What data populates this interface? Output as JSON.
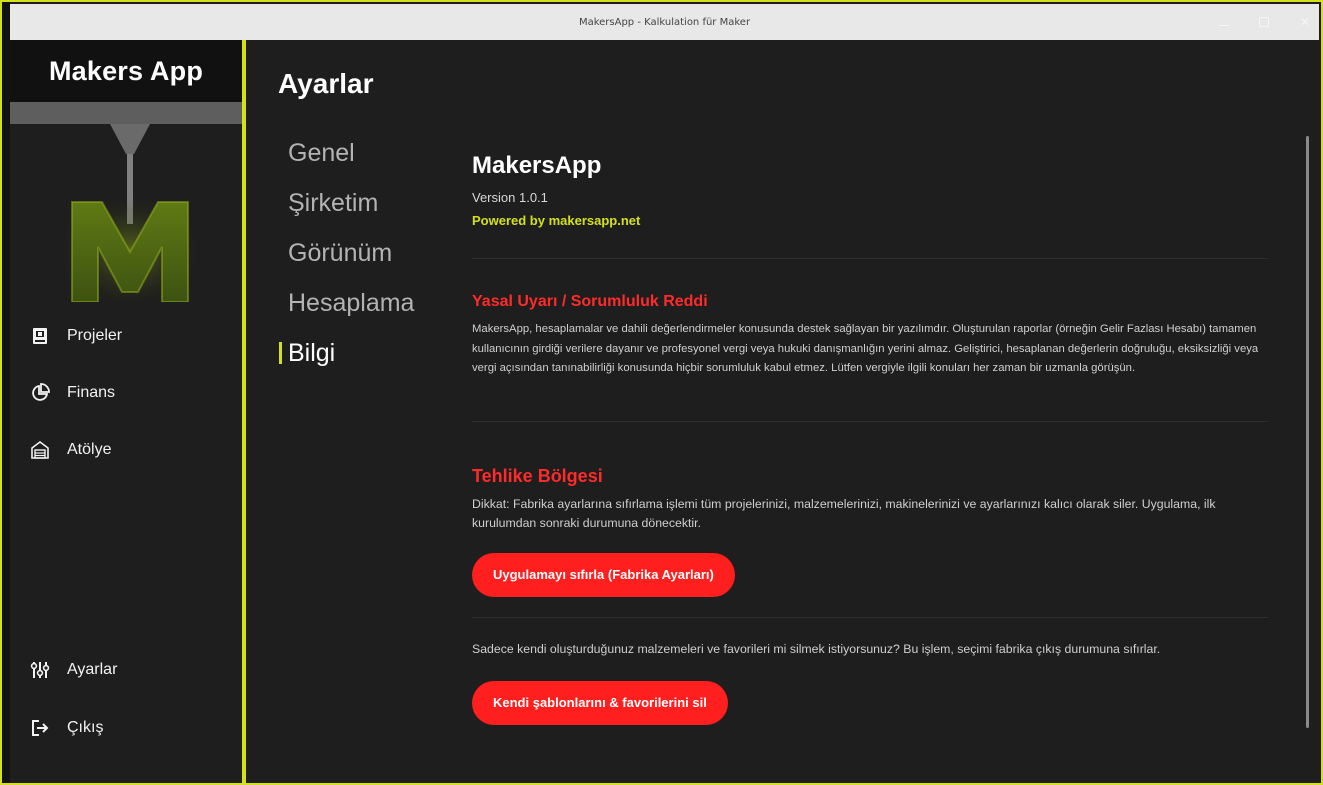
{
  "window": {
    "title": "MakersApp - Kalkulation für Maker"
  },
  "sidebar": {
    "brand": "Makers App",
    "items": [
      {
        "label": "Projeler",
        "icon": "projects-icon"
      },
      {
        "label": "Finans",
        "icon": "pie-chart-icon"
      },
      {
        "label": "Atölye",
        "icon": "garage-icon"
      }
    ],
    "bottom_items": [
      {
        "label": "Ayarlar",
        "icon": "sliders-icon"
      },
      {
        "label": "Çıkış",
        "icon": "logout-icon"
      }
    ]
  },
  "page": {
    "title": "Ayarlar"
  },
  "settings_nav": {
    "items": [
      "Genel",
      "Şirketim",
      "Görünüm",
      "Hesaplama",
      "Bilgi"
    ],
    "active": "Bilgi"
  },
  "info": {
    "app_name": "MakersApp",
    "version": "Version 1.0.1",
    "powered_by": "Powered by makersapp.net"
  },
  "disclaimer": {
    "title": "Yasal Uyarı / Sorumluluk Reddi",
    "text": "MakersApp, hesaplamalar ve dahili değerlendirmeler konusunda destek sağlayan bir yazılımdır. Oluşturulan raporlar (örneğin Gelir Fazlası Hesabı) tamamen kullanıcının girdiği verilere dayanır ve profesyonel vergi veya hukuki danışmanlığın yerini almaz. Geliştirici, hesaplanan değerlerin doğruluğu, eksiksizliği veya vergi açısından tanınabilirliği konusunda hiçbir sorumluluk kabul etmez. Lütfen vergiyle ilgili konuları her zaman bir uzmanla görüşün."
  },
  "danger_zone": {
    "title": "Tehlike Bölgesi",
    "text": "Dikkat: Fabrika ayarlarına sıfırlama işlemi tüm projelerinizi, malzemelerinizi, makinelerinizi ve ayarlarınızı kalıcı olarak siler. Uygulama, ilk kurulumdan sonraki durumuna dönecektir.",
    "reset_button": "Uygulamayı sıfırla (Fabrika Ayarları)",
    "templates_text": "Sadece kendi oluşturduğunuz malzemeleri ve favorileri mi silmek istiyorsunuz? Bu işlem, seçimi fabrika çıkış durumuna sıfırlar.",
    "delete_templates_button": "Kendi şablonlarını & favorilerini sil"
  },
  "colors": {
    "accent": "#d4e11a",
    "danger": "#ff1f1f",
    "background": "#1e1e1e"
  }
}
